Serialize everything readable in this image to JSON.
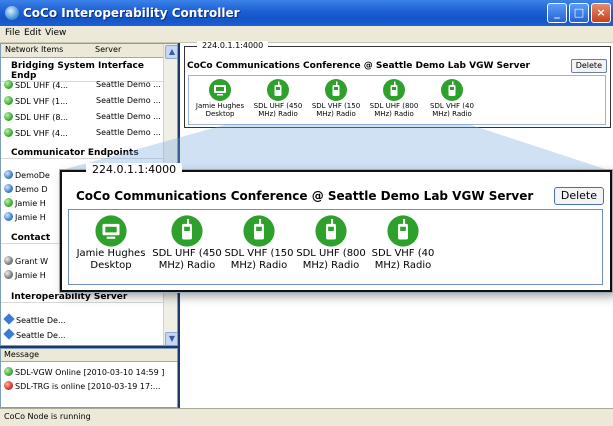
{
  "window": {
    "title": "CoCo Interoperability Controller",
    "minimize_glyph": "_",
    "maximize_glyph": "□",
    "close_glyph": "×"
  },
  "menu": [
    "File",
    "Edit",
    "View"
  ],
  "left_panel": {
    "columns": [
      "Network Items",
      "Server"
    ],
    "sections": [
      {
        "title": "Bridging System Interface Endp",
        "items": [
          {
            "name": "SDL UHF (4...",
            "server": "Seattle Demo ..."
          },
          {
            "name": "SDL VHF (1...",
            "server": "Seattle Demo ..."
          },
          {
            "name": "SDL UHF (8...",
            "server": "Seattle Demo ..."
          },
          {
            "name": "SDL VHF (4...",
            "server": "Seattle Demo ..."
          }
        ]
      },
      {
        "title": "Communicator Endpoints",
        "items": [
          {
            "name": "DemoDe",
            "server": ""
          },
          {
            "name": "Demo D",
            "server": ""
          },
          {
            "name": "Jamie H",
            "server": ""
          },
          {
            "name": "Jamie H",
            "server": ""
          }
        ]
      },
      {
        "title": "Contact",
        "items": [
          {
            "name": "Grant W",
            "server": ""
          },
          {
            "name": "Jamie H",
            "server": ""
          }
        ]
      },
      {
        "title": "Interoperability Server",
        "items": [
          {
            "name": "Seattle De...",
            "server": ""
          },
          {
            "name": "Seattle De...",
            "server": ""
          }
        ]
      }
    ]
  },
  "messages": {
    "title": "Message",
    "items": [
      {
        "text": "SDL-VGW Online [2010-03-10 14:59 ]",
        "status": "green"
      },
      {
        "text": "SDL-TRG is online [2010-03-19 17:...",
        "status": "red"
      }
    ]
  },
  "conference": {
    "address": "224.0.1.1:4000",
    "title": "CoCo Communications Conference @ Seattle Demo Lab VGW Server",
    "delete_label": "Delete",
    "endpoints": [
      {
        "label": "Jamie Hughes Desktop",
        "type": "desktop"
      },
      {
        "label": "SDL UHF (450 MHz) Radio",
        "type": "radio"
      },
      {
        "label": "SDL VHF (150 MHz) Radio",
        "type": "radio"
      },
      {
        "label": "SDL UHF (800 MHz) Radio",
        "type": "radio"
      },
      {
        "label": "SDL VHF (40 MHz) Radio",
        "type": "radio"
      }
    ]
  },
  "status": "CoCo Node is running",
  "colors": {
    "accent_green": "#2ea12c",
    "title_blue": "#1f62d6",
    "background": "#1b3a6b"
  }
}
